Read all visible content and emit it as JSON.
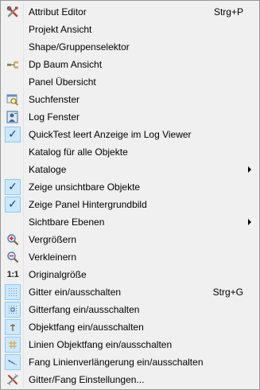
{
  "menu": {
    "items": [
      {
        "label": "Attribut Editor",
        "shortcut": "Strg+P",
        "icon": "tools-icon"
      },
      {
        "label": "Projekt Ansicht"
      },
      {
        "label": "Shape/Gruppenselektor"
      },
      {
        "label": "Dp Baum Ansicht",
        "icon": "tree-icon"
      },
      {
        "label": "Panel Übersicht"
      },
      {
        "label": "Suchfenster",
        "icon": "search-window-icon"
      },
      {
        "label": "Log Fenster",
        "icon": "log-window-icon"
      },
      {
        "label": "QuickTest leert Anzeige im Log Viewer",
        "checked": true
      },
      {
        "label": "Katalog für alle Objekte"
      },
      {
        "label": "Kataloge",
        "submenu": true
      },
      {
        "label": "Zeige unsichtbare Objekte",
        "checked": true
      },
      {
        "label": "Zeige Panel Hintergrundbild",
        "checked": true
      },
      {
        "label": "Sichtbare Ebenen",
        "submenu": true
      },
      {
        "label": "Vergrößern",
        "icon": "zoom-in-icon"
      },
      {
        "label": "Verkleinern",
        "icon": "zoom-out-icon"
      },
      {
        "label": "Originalgröße",
        "icon": "original-size-icon",
        "icon_text": "1:1"
      },
      {
        "label": "Gitter ein/ausschalten",
        "shortcut": "Strg+G",
        "icon": "grid-icon"
      },
      {
        "label": "Gitterfang ein/ausschalten",
        "icon": "grid-snap-icon"
      },
      {
        "label": "Objektfang ein/ausschalten",
        "icon": "object-snap-icon"
      },
      {
        "label": "Linien Objektfang ein/ausschalten",
        "icon": "line-snap-icon"
      },
      {
        "label": "Fang Linienverlängerung ein/ausschalten",
        "icon": "line-extension-snap-icon"
      },
      {
        "label": "Gitter/Fang Einstellungen...",
        "icon": "grid-settings-icon"
      }
    ]
  },
  "colors": {
    "menu_background": "#f0f0f0",
    "menu_border": "#979797",
    "check_background": "#cce8ff",
    "check_border": "#90c8f6"
  }
}
